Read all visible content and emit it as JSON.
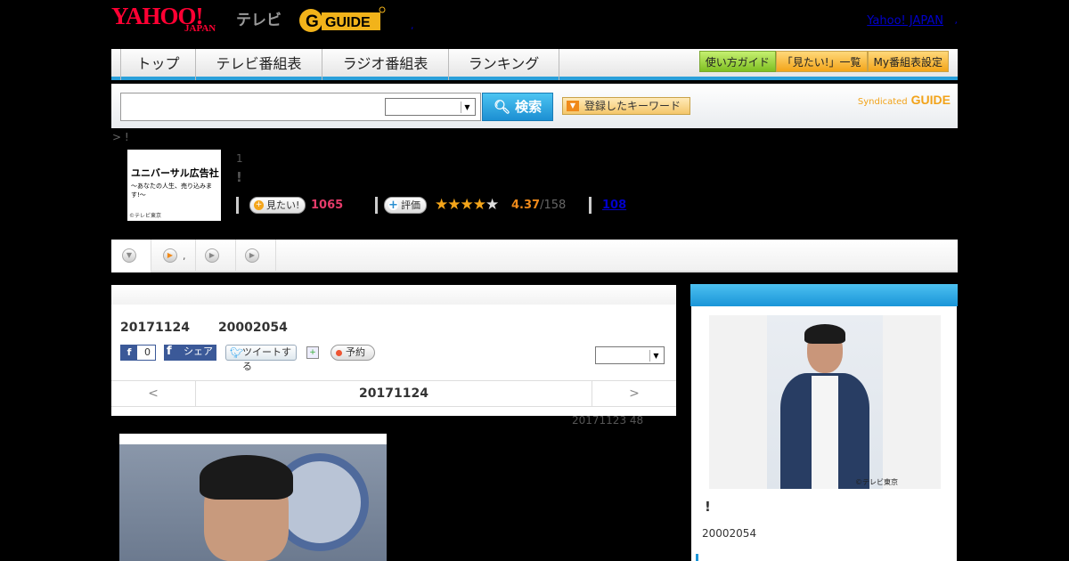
{
  "header": {
    "brand": "YAHOO!",
    "brand_sub": "JAPAN",
    "service": "テレビ",
    "gguide": "G-GUIDE",
    "yahoo_link": "Yahoo! JAPAN",
    "dot1": ",",
    "dot2": ","
  },
  "nav": {
    "tabs": [
      "トップ",
      "テレビ番組表",
      "ラジオ番組表",
      "ランキング"
    ],
    "right_buttons": [
      "使い方ガイド",
      "「見たい!」一覧",
      "My番組表設定"
    ]
  },
  "search": {
    "value": "",
    "select_value": "",
    "button_label": "検索",
    "keywords_label": "登録したキーワード",
    "syndicated": "Syndicated",
    "syndicated_brand": "GUIDE"
  },
  "breadcrumb": "> !",
  "program": {
    "thumb_title": "ユニバーサル広告社",
    "thumb_subtitle": "〜あなたの人生、売り込みます!〜",
    "thumb_credit": "©テレビ東京",
    "number": "1",
    "title": "!",
    "mitai_label": "見たい!",
    "mitai_count": "1065",
    "rate_label": "評価",
    "stars": "★★★★",
    "star_empty": "★",
    "rating": "4.37",
    "rating_total": "/158",
    "reviews": "108"
  },
  "tabs": {
    "dot": ","
  },
  "main": {
    "date": "20171124",
    "time": "20002054",
    "fb_like_count": "0",
    "fb_share": "シェア",
    "tweet": "ツイートする",
    "reserve": "予約",
    "select_value": "",
    "prev": "<",
    "next": ">",
    "nav_date": "20171124",
    "note": "20171123  48"
  },
  "sidebar": {
    "photo_credit": "©テレビ東京",
    "title": "!",
    "time": "20002054"
  }
}
